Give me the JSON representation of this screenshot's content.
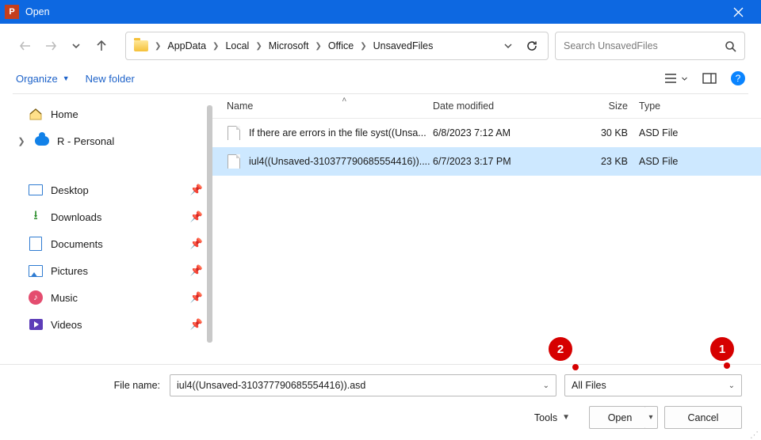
{
  "window": {
    "app_letter": "P",
    "title": "Open"
  },
  "breadcrumbs": [
    "AppData",
    "Local",
    "Microsoft",
    "Office",
    "UnsavedFiles"
  ],
  "search": {
    "placeholder": "Search UnsavedFiles"
  },
  "toolbar": {
    "organize_label": "Organize",
    "new_folder_label": "New folder"
  },
  "tree": {
    "home": "Home",
    "personal": "R - Personal",
    "desktop": "Desktop",
    "downloads": "Downloads",
    "documents": "Documents",
    "pictures": "Pictures",
    "music": "Music",
    "videos": "Videos"
  },
  "columns": {
    "name": "Name",
    "date": "Date modified",
    "size": "Size",
    "type": "Type"
  },
  "files": [
    {
      "name": "If there are errors in the file syst((Unsa...",
      "date": "6/8/2023 7:12 AM",
      "size": "30 KB",
      "type": "ASD File",
      "sel": false
    },
    {
      "name": "iul4((Unsaved-310377790685554416))....",
      "date": "6/7/2023 3:17 PM",
      "size": "23 KB",
      "type": "ASD File",
      "sel": true
    }
  ],
  "footer": {
    "filename_label": "File name:",
    "filename_value": "iul4((Unsaved-310377790685554416)).asd",
    "filter_value": "All Files",
    "tools_label": "Tools",
    "open_label": "Open",
    "cancel_label": "Cancel"
  },
  "callouts": {
    "one": "1",
    "two": "2"
  }
}
